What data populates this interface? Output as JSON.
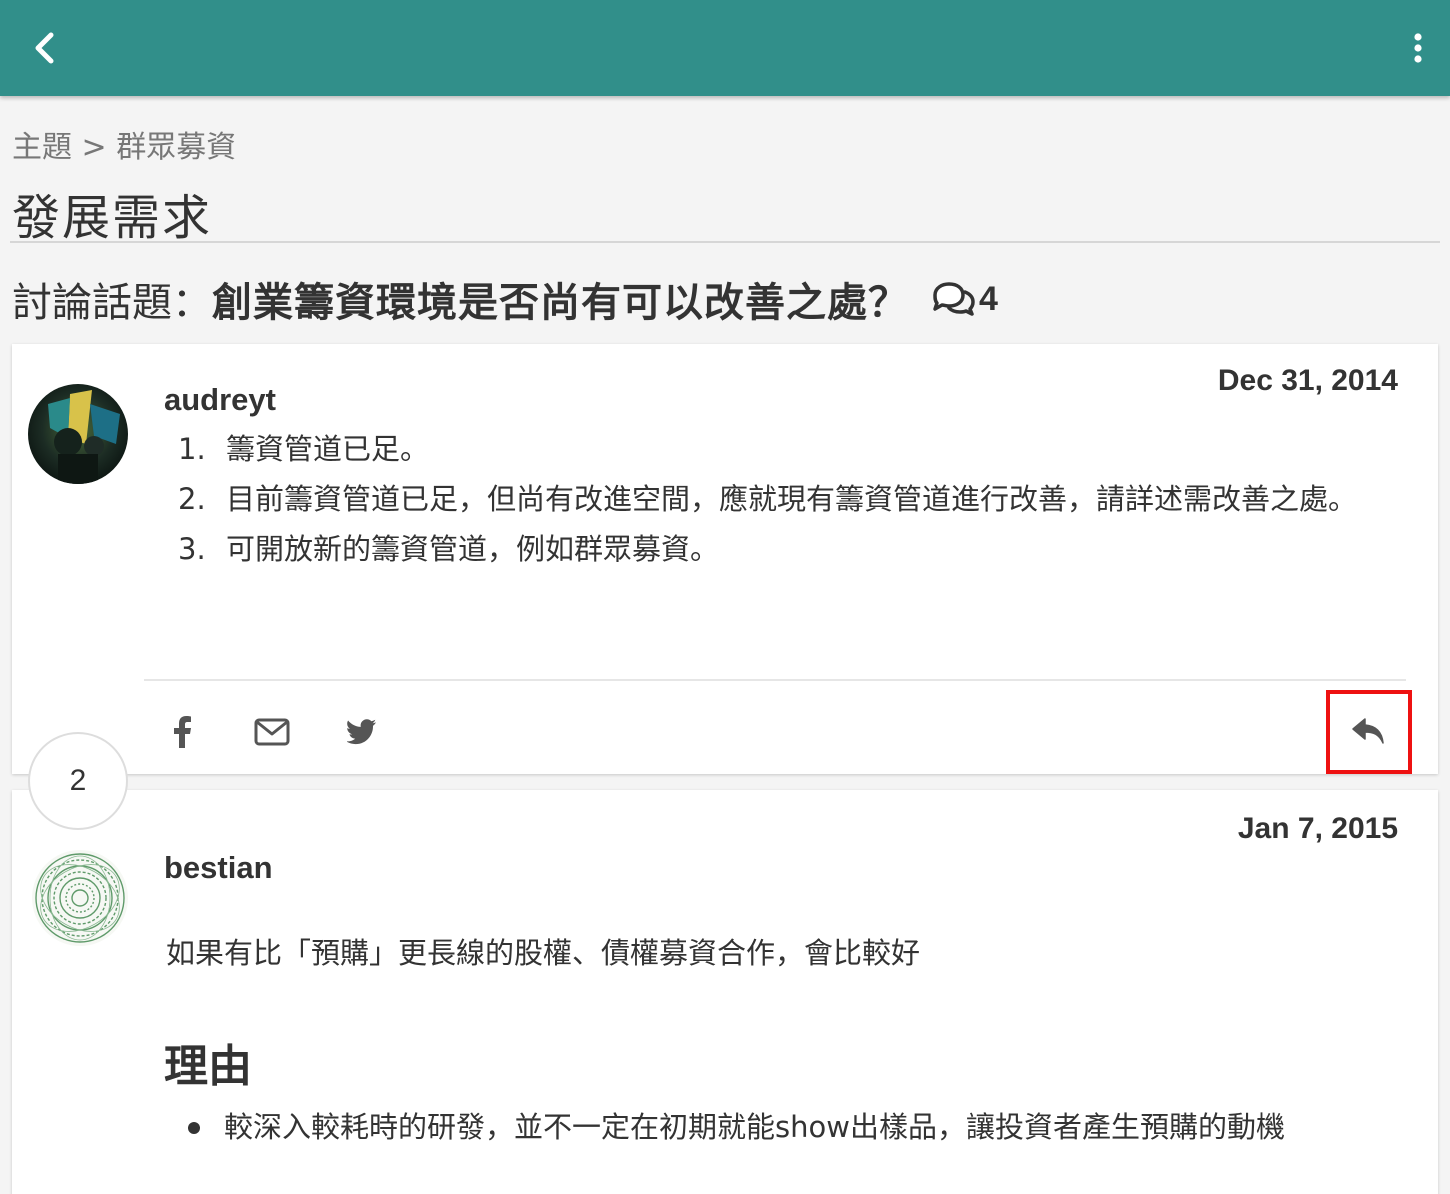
{
  "header": {
    "back_icon": "chevron-left-icon",
    "menu_icon": "more-vertical-icon",
    "color": "#318f8a"
  },
  "breadcrumb": "主題 > 群眾募資",
  "page_title": "發展需求",
  "topic": {
    "prefix": "討論話題：",
    "title": "創業籌資環境是否尚有可以改善之處？",
    "comment_icon": "comments-icon",
    "comment_count": "4"
  },
  "posts": [
    {
      "author": "audreyt",
      "date": "Dec 31, 2014",
      "items": [
        {
          "num": "1.",
          "text": "籌資管道已足。"
        },
        {
          "num": "2.",
          "text": "目前籌資管道已足，但尚有改進空間，應就現有籌資管道進行改善，請詳述需改善之處。"
        },
        {
          "num": "3.",
          "text": "可開放新的籌資管道，例如群眾募資。"
        }
      ],
      "share_icons": [
        "facebook-icon",
        "email-icon",
        "twitter-icon"
      ],
      "reply_icon": "reply-icon"
    },
    {
      "number": "2",
      "author": "bestian",
      "date": "Jan 7, 2015",
      "text": "如果有比「預購」更長線的股權、債權募資合作，會比較好",
      "heading": "理由",
      "bullets": [
        "較深入較耗時的研發，並不一定在初期就能show出樣品，讓投資者產生預購的動機"
      ]
    }
  ],
  "colors": {
    "accent": "#318f8a",
    "highlight": "#ee1111"
  }
}
